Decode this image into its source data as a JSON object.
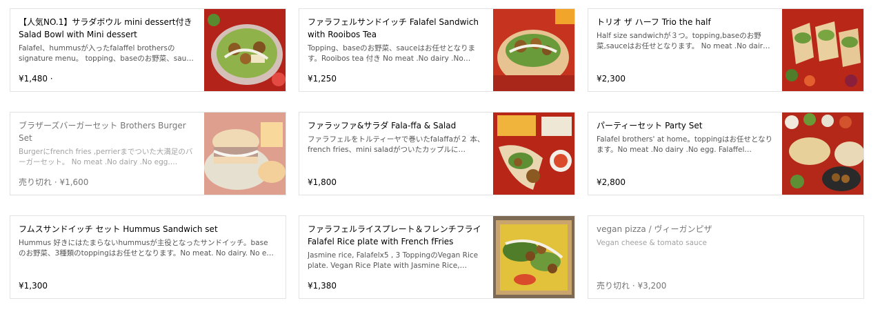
{
  "menu_items": [
    {
      "title": "【人気NO.1】サラダボウル mini dessert付き Salad Bowl with Mini dessert",
      "description": "Falafel、hummusが入ったfalaffel brothersの signature menu。 topping、baseのお野菜、sau…",
      "price": "¥1,480 ·",
      "image": "salad-bowl-photo"
    },
    {
      "title": "ファラフェルサンドイッチ Falafel Sandwich with Rooibos Tea",
      "description": "Topping、baseのお野菜、sauceはお任せとなりま す。Rooibos tea 付き No meat .No dairy .No egg.…",
      "price": "¥1,250",
      "image": "falafel-sandwich-photo"
    },
    {
      "title": "トリオ ザ ハーフ Trio the half",
      "description": "Half size sandwichが３つ。topping,baseのお野 菜,sauceはお任せとなります。 No meat .No dair…",
      "price": "¥2,300",
      "image": "trio-half-photo"
    },
    {
      "title": "ブラザーズバーガーセット Brothers Burger Set",
      "description": "Burgerにfrench fries ,perrierまでついた大満足のバ ーガーセット。 No meat .No dairy .No egg. Burg…",
      "price": "売り切れ · ¥1,600",
      "image": "burger-set-photo"
    },
    {
      "title": "ファラッファ&サラダ Fala-ffa & Salad",
      "description": "ファラフェルをトルティーヤで巻いたfalaffaが２ 本、french fries、mini saladがついたカップルに…",
      "price": "¥1,800",
      "image": "wrap-salad-photo"
    },
    {
      "title": "パーティーセット Party Set",
      "description": "Falafel brothers' at home。toppingはお任せとなり ます。No meat .No dairy .No egg. Falaffel Brothe…",
      "price": "¥2,800",
      "image": "party-set-photo"
    },
    {
      "title": "フムスサンドイッチ セット Hummus Sandwich set",
      "description": "Hummus 好きにはたまらないhummusが主役となったサンドイッチ。base のお野菜、3種類のtoppingはお任せとなります。No meat. No dairy. No e…",
      "price": "¥1,300",
      "image": ""
    },
    {
      "title": "ファラフェルライスプレート＆フレンチフライ Falafel Rice plate with French fFries",
      "description": "Jasmine rice, Falafelx5 , 3 ToppingのVegan Rice plate. Vegan Rice Plate with Jasmine Rice, Falaff…",
      "price": "¥1,380",
      "image": "rice-plate-photo"
    },
    {
      "title": "vegan pizza / ヴィーガンピザ",
      "description": "Vegan cheese & tomato sauce",
      "price": "売り切れ · ¥3,200",
      "image": ""
    }
  ]
}
